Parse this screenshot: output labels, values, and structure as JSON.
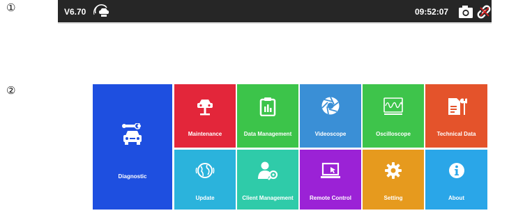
{
  "markers": {
    "one": "①",
    "two": "②"
  },
  "topbar": {
    "version": "V6.70",
    "time": "09:52:07",
    "vin_icon": "vin-car-icon",
    "camera_icon": "camera-icon",
    "link_icon": "link-icon",
    "close_icon": "close-icon",
    "close_color": "#e02020"
  },
  "tiles": [
    {
      "label": "Diagnostic",
      "color": "#1e4fe0",
      "icon": "car-wrench-icon"
    },
    {
      "label": "Maintenance",
      "color": "#e3263a",
      "icon": "car-lift-icon"
    },
    {
      "label": "Data Management",
      "color": "#3cc44a",
      "icon": "clipboard-chart-icon"
    },
    {
      "label": "Videoscope",
      "color": "#3a8fd6",
      "icon": "aperture-icon"
    },
    {
      "label": "Oscilloscope",
      "color": "#3ec44b",
      "icon": "waveform-icon"
    },
    {
      "label": "Technical Data",
      "color": "#e4532b",
      "icon": "document-wrench-icon"
    },
    {
      "label": "Update",
      "color": "#2bb3dc",
      "icon": "globe-icon"
    },
    {
      "label": "Client Management",
      "color": "#2fcba9",
      "icon": "user-wrench-icon"
    },
    {
      "label": "Remote Control",
      "color": "#9b22d6",
      "icon": "monitor-cursor-icon"
    },
    {
      "label": "Setting",
      "color": "#e69a1e",
      "icon": "gear-icon"
    },
    {
      "label": "About",
      "color": "#2aa6e8",
      "icon": "info-icon"
    }
  ]
}
